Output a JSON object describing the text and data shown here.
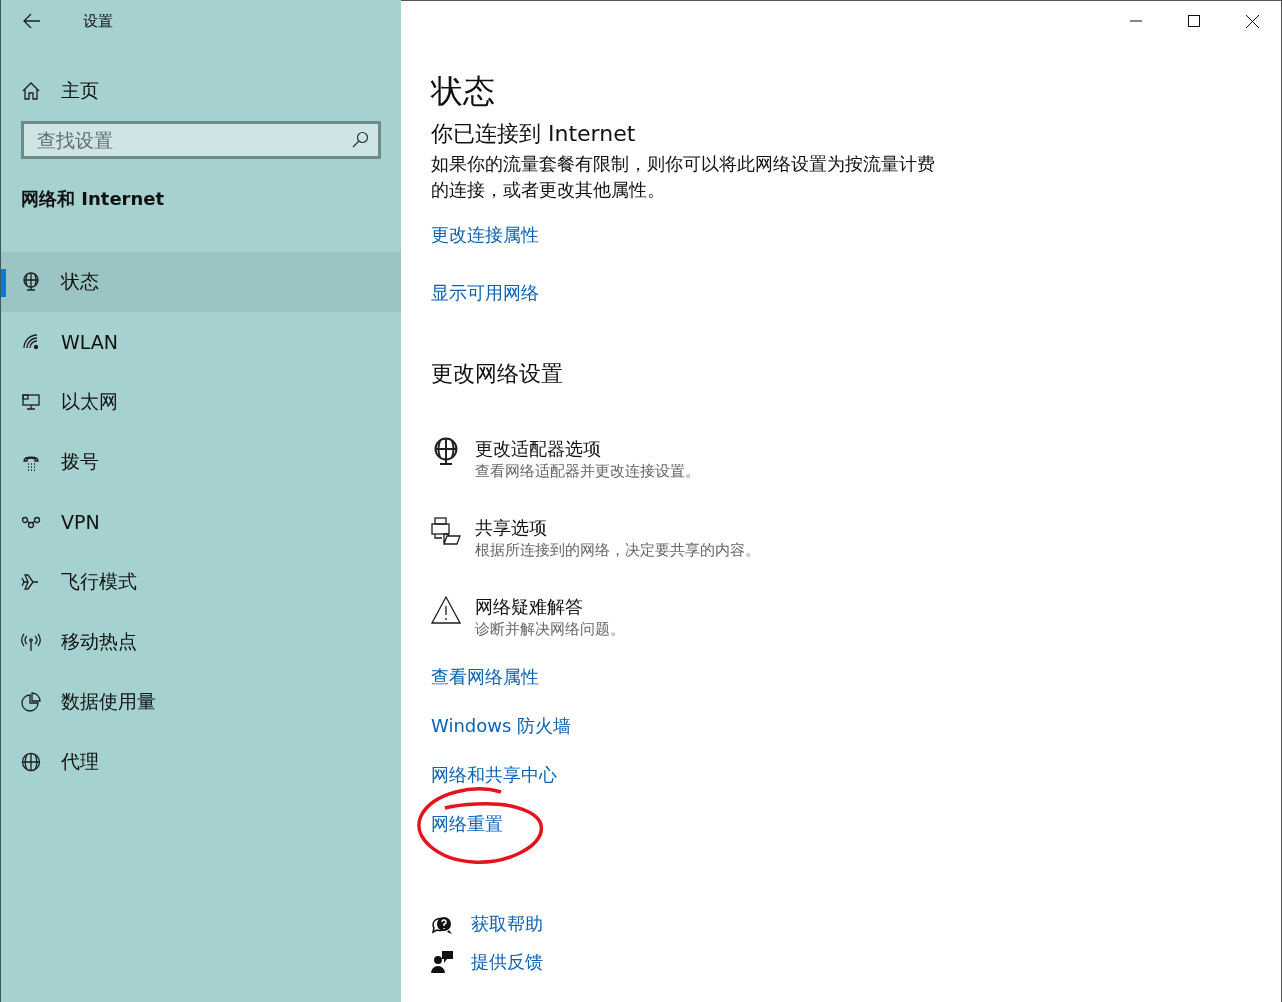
{
  "window": {
    "title": "设置"
  },
  "sidebar": {
    "home": "主页",
    "search": {
      "placeholder": "查找设置"
    },
    "section": "网络和 Internet",
    "items": [
      {
        "label": "状态",
        "selected": true
      },
      {
        "label": "WLAN",
        "selected": false
      },
      {
        "label": "以太网",
        "selected": false
      },
      {
        "label": "拨号",
        "selected": false
      },
      {
        "label": "VPN",
        "selected": false
      },
      {
        "label": "飞行模式",
        "selected": false
      },
      {
        "label": "移动热点",
        "selected": false
      },
      {
        "label": "数据使用量",
        "selected": false
      },
      {
        "label": "代理",
        "selected": false
      }
    ]
  },
  "main": {
    "title": "状态",
    "connection": "你已连接到 Internet",
    "description": "如果你的流量套餐有限制，则你可以将此网络设置为按流量计费的连接，或者更改其他属性。",
    "links": [
      "更改连接属性",
      "显示可用网络"
    ],
    "change_heading": "更改网络设置",
    "options": [
      {
        "title": "更改适配器选项",
        "subtitle": "查看网络适配器并更改连接设置。"
      },
      {
        "title": "共享选项",
        "subtitle": "根据所连接到的网络，决定要共享的内容。"
      },
      {
        "title": "网络疑难解答",
        "subtitle": "诊断并解决网络问题。"
      }
    ],
    "more_links": [
      {
        "text": "查看网络属性",
        "circled": false
      },
      {
        "text": "Windows 防火墙",
        "circled": false
      },
      {
        "text": "网络和共享中心",
        "circled": false
      },
      {
        "text": "网络重置",
        "circled": true
      }
    ],
    "help": [
      "获取帮助",
      "提供反馈"
    ]
  }
}
